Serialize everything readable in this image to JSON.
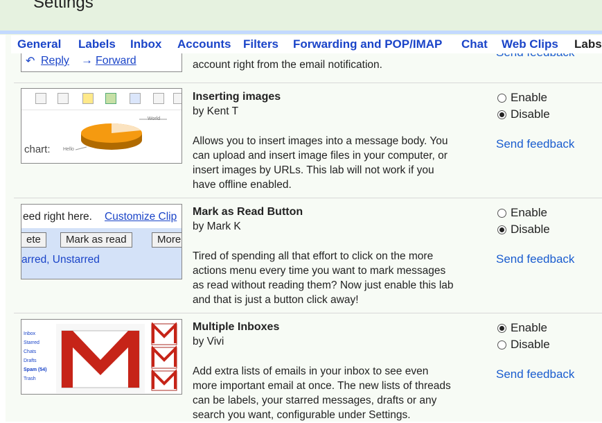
{
  "page": {
    "title": "Settings"
  },
  "tabs": [
    {
      "label": "General"
    },
    {
      "label": "Labels"
    },
    {
      "label": "Inbox"
    },
    {
      "label": "Accounts"
    },
    {
      "label": "Filters"
    },
    {
      "label": "Forwarding and POP/IMAP"
    },
    {
      "label": "Chat"
    },
    {
      "label": "Web Clips"
    },
    {
      "label": "Labs"
    }
  ],
  "top_partial": {
    "reply_label": "Reply",
    "forward_label": "Forward",
    "desc_tail": "account right from the email notification.",
    "feedback": "Send feedback"
  },
  "labs": [
    {
      "title": "Inserting images",
      "author": "by Kent T",
      "description": [
        "Allows you to insert images into a message body. You",
        "can upload and insert image files in your computer, or",
        "insert images by URLs. This lab will not work if you",
        "have offline enabled."
      ],
      "enable_label": "Enable",
      "disable_label": "Disable",
      "selected": "disable",
      "feedback": "Send feedback",
      "thumb": {
        "chart_label": "chart:",
        "legend_world": "World",
        "legend_hello": "Hello"
      }
    },
    {
      "title": "Mark as Read Button",
      "author": "by Mark K",
      "description": [
        "Tired of spending all that effort to click on the more",
        "actions menu every time you want to mark messages",
        "as read without reading them? Now just enable this lab",
        "and that is just a button click away!"
      ],
      "enable_label": "Enable",
      "disable_label": "Disable",
      "selected": "disable",
      "feedback": "Send feedback",
      "thumb": {
        "text": "eed right here.",
        "link": "Customize Clip",
        "btn_delete": "ete",
        "btn_mark": "Mark as read",
        "btn_more": "More",
        "starred": "arred, Unstarred"
      }
    },
    {
      "title": "Multiple Inboxes",
      "author": "by Vivi",
      "description": [
        "Add extra lists of emails in your inbox to see even",
        "more important email at once. The new lists of threads",
        "can be labels, your starred messages, drafts or any",
        "search you want, configurable under Settings."
      ],
      "enable_label": "Enable",
      "disable_label": "Disable",
      "selected": "enable",
      "feedback": "Send feedback",
      "thumb": {
        "nav": [
          "Inbox",
          "Starred",
          "Chats",
          "Drafts",
          "Spam (54)",
          "Trash"
        ]
      }
    }
  ]
}
